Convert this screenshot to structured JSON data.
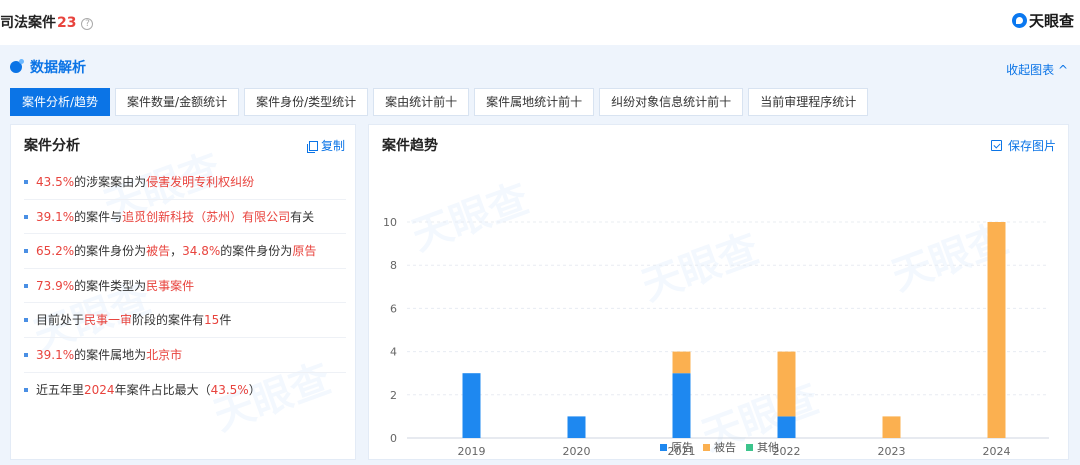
{
  "header": {
    "title": "司法案件",
    "count": "23",
    "help": "?",
    "brand": "天眼查"
  },
  "panel": {
    "title": "数据解析",
    "collapse_label": "收起图表 ^"
  },
  "tabs": [
    {
      "label": "案件分析/趋势",
      "active": true
    },
    {
      "label": "案件数量/金额统计",
      "active": false
    },
    {
      "label": "案件身份/类型统计",
      "active": false
    },
    {
      "label": "案由统计前十",
      "active": false
    },
    {
      "label": "案件属地统计前十",
      "active": false
    },
    {
      "label": "纠纷对象信息统计前十",
      "active": false
    },
    {
      "label": "当前审理程序统计",
      "active": false
    }
  ],
  "analysis": {
    "title": "案件分析",
    "copy_label": "复制",
    "items": [
      [
        {
          "t": "43.5%",
          "h": true
        },
        {
          "t": "的涉案案由为",
          "h": false
        },
        {
          "t": "侵害发明专利权纠纷",
          "h": true
        }
      ],
      [
        {
          "t": "39.1%",
          "h": true
        },
        {
          "t": "的案件与",
          "h": false
        },
        {
          "t": "追觅创新科技（苏州）有限公司",
          "h": true
        },
        {
          "t": "有关",
          "h": false
        }
      ],
      [
        {
          "t": "65.2%",
          "h": true
        },
        {
          "t": "的案件身份为",
          "h": false
        },
        {
          "t": "被告",
          "h": true
        },
        {
          "t": "，",
          "h": false
        },
        {
          "t": "34.8%",
          "h": true
        },
        {
          "t": "的案件身份为",
          "h": false
        },
        {
          "t": "原告",
          "h": true
        }
      ],
      [
        {
          "t": "73.9%",
          "h": true
        },
        {
          "t": "的案件类型为",
          "h": false
        },
        {
          "t": "民事案件",
          "h": true
        }
      ],
      [
        {
          "t": "目前处于",
          "h": false
        },
        {
          "t": "民事一审",
          "h": true
        },
        {
          "t": "阶段的案件有",
          "h": false
        },
        {
          "t": "15",
          "h": true
        },
        {
          "t": "件",
          "h": false
        }
      ],
      [
        {
          "t": "39.1%",
          "h": true
        },
        {
          "t": "的案件属地为",
          "h": false
        },
        {
          "t": "北京市",
          "h": true
        }
      ],
      [
        {
          "t": "近五年里",
          "h": false
        },
        {
          "t": "2024",
          "h": true
        },
        {
          "t": "年案件占比最大（",
          "h": false
        },
        {
          "t": "43.5%",
          "h": true
        },
        {
          "t": "）",
          "h": false
        }
      ]
    ]
  },
  "trend": {
    "title": "案件趋势",
    "save_label": "保存图片"
  },
  "colors": {
    "accent": "#0b74e6",
    "highlight": "#e8433d",
    "plaintiff": "#1e88f0",
    "defendant": "#fbb050",
    "other": "#3cc48c"
  },
  "chart_data": {
    "type": "bar",
    "stacked": true,
    "categories": [
      "2019",
      "2020",
      "2021",
      "2022",
      "2023",
      "2024"
    ],
    "series": [
      {
        "name": "原告",
        "values": [
          3,
          1,
          3,
          1,
          0,
          0
        ]
      },
      {
        "name": "被告",
        "values": [
          0,
          0,
          1,
          3,
          1,
          10
        ]
      },
      {
        "name": "其他",
        "values": [
          0,
          0,
          0,
          0,
          0,
          0
        ]
      }
    ],
    "ylim": [
      0,
      10
    ],
    "yticks": [
      0,
      2,
      4,
      6,
      8,
      10
    ],
    "grid": true,
    "legend": "bottom"
  }
}
